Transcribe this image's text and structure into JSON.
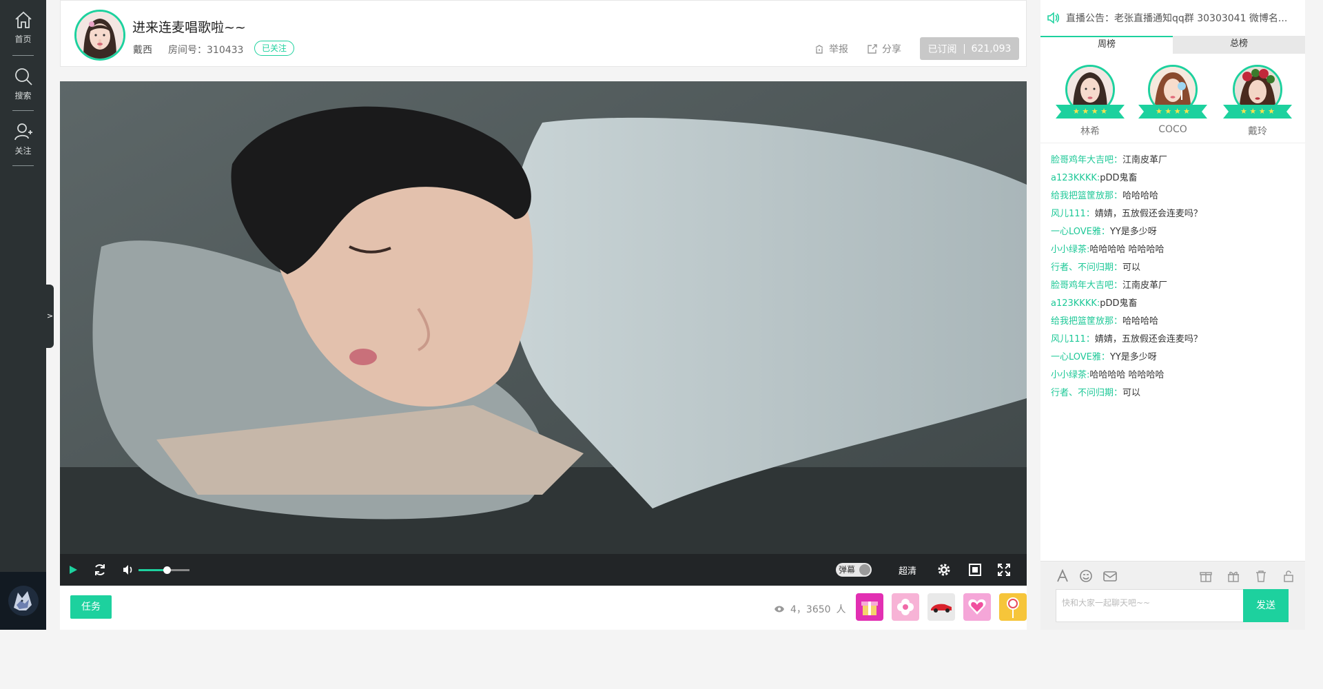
{
  "sidebar": {
    "items": [
      {
        "label": "首页",
        "icon": "home-icon"
      },
      {
        "label": "搜索",
        "icon": "search-icon"
      },
      {
        "label": "关注",
        "icon": "user-follow-icon"
      }
    ],
    "expand_label": ">"
  },
  "header": {
    "title": "进来连麦唱歌啦~~",
    "anchor_name": "戴西",
    "room_no": "房间号：310433",
    "follow_status": "已关注",
    "report_label": "举报",
    "share_label": "分享",
    "subscribe_label": "已订阅",
    "subscribe_count": "621,093"
  },
  "player": {
    "danmaku_label": "弹幕",
    "quality_label": "超清",
    "volume_level": 0.55
  },
  "bottom": {
    "task_label": "任务",
    "viewers_count": "4，3650",
    "viewers_unit": "人",
    "gifts": [
      {
        "icon": "gift-box-icon",
        "color": "#e22fb2"
      },
      {
        "icon": "flower-icon",
        "color": "#f7b3d6"
      },
      {
        "icon": "sports-car-icon",
        "color": "#e9e9e9"
      },
      {
        "icon": "heart-icon",
        "color": "#f5a6d8"
      },
      {
        "icon": "lollipop-icon",
        "color": "#f6c53a"
      }
    ]
  },
  "right": {
    "notice": "直播公告：老张直播通知qq群 30303041  微博名...",
    "tabs": [
      "周榜",
      "总榜"
    ],
    "active_tab": 0,
    "rank": [
      {
        "name": "林希"
      },
      {
        "name": "COCO"
      },
      {
        "name": "戴玲"
      }
    ],
    "chat": [
      {
        "user": "脸哥鸡年大吉吧：",
        "text": "江南皮革厂"
      },
      {
        "user": "a123KKKK:",
        "text": "pDD鬼畜"
      },
      {
        "user": "给我把篮筐放那：",
        "text": "哈哈哈哈"
      },
      {
        "user": "风儿111：",
        "text": "婧婧，五放假还会连麦吗？"
      },
      {
        "user": "一心LOVE雅：",
        "text": "YY是多少呀"
      },
      {
        "user": "小小绿茶:",
        "text": "哈哈哈哈 哈哈哈哈"
      },
      {
        "user": "行者、不问归期：",
        "text": "可以"
      },
      {
        "user": "脸哥鸡年大吉吧：",
        "text": "江南皮革厂"
      },
      {
        "user": "a123KKKK:",
        "text": "pDD鬼畜"
      },
      {
        "user": "给我把篮筐放那：",
        "text": "哈哈哈哈"
      },
      {
        "user": "风儿111：",
        "text": "婧婧，五放假还会连麦吗？"
      },
      {
        "user": "一心LOVE雅：",
        "text": "YY是多少呀"
      },
      {
        "user": "小小绿茶:",
        "text": "哈哈哈哈 哈哈哈哈"
      },
      {
        "user": "行者、不问归期：",
        "text": "可以"
      }
    ],
    "input_placeholder": "快和大家一起聊天吧~~",
    "send_label": "发送"
  },
  "colors": {
    "accent": "#1dd19e",
    "sidebar_bg": "#2b3133"
  }
}
